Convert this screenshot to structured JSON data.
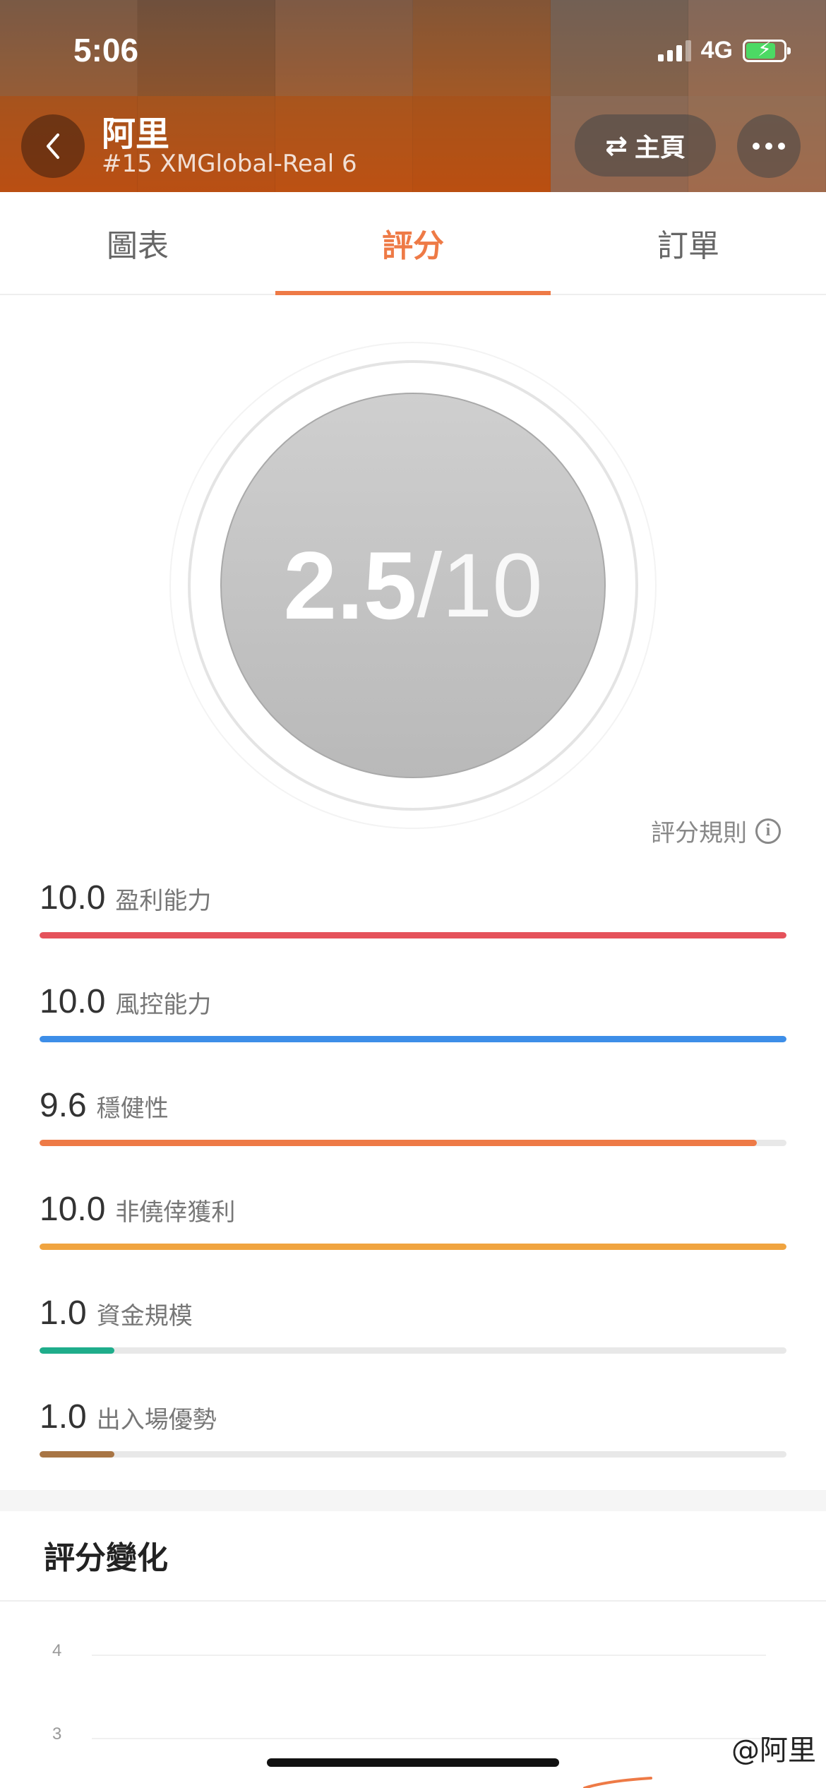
{
  "status_bar": {
    "time": "5:06",
    "network": "4G",
    "battery_bolt": "⚡",
    "battery_level": 0.8
  },
  "header": {
    "title": "阿里",
    "subtitle": "#15 XMGlobal-Real 6",
    "home_label": "主頁",
    "swap_icon": "⇄",
    "back_icon": "chevron-left-icon",
    "more_icon": "more-icon"
  },
  "tabs": [
    {
      "label": "圖表",
      "active": false
    },
    {
      "label": "評分",
      "active": true
    },
    {
      "label": "訂單",
      "active": false
    }
  ],
  "score": {
    "value": "2.5",
    "max": "/10",
    "rules_label": "評分規則",
    "info_glyph": "i"
  },
  "metrics": [
    {
      "value": "10.0",
      "name": "盈利能力",
      "fraction": 1.0,
      "color": "#e5525b"
    },
    {
      "value": "10.0",
      "name": "風控能力",
      "fraction": 1.0,
      "color": "#3d8ee8"
    },
    {
      "value": "9.6",
      "name": "穩健性",
      "fraction": 0.96,
      "color": "#ee7a46"
    },
    {
      "value": "10.0",
      "name": "非僥倖獲利",
      "fraction": 1.0,
      "color": "#f0a440"
    },
    {
      "value": "1.0",
      "name": "資金規模",
      "fraction": 0.1,
      "color": "#1fad8b"
    },
    {
      "value": "1.0",
      "name": "出入場優勢",
      "fraction": 0.1,
      "color": "#a87544"
    }
  ],
  "history": {
    "title": "評分變化"
  },
  "chart_data": {
    "type": "line",
    "y_ticks": [
      "4",
      "3"
    ],
    "grid": true,
    "series_color": "#ee7a46"
  },
  "watermark": "@阿里",
  "colors": {
    "accent": "#ee7a46"
  }
}
